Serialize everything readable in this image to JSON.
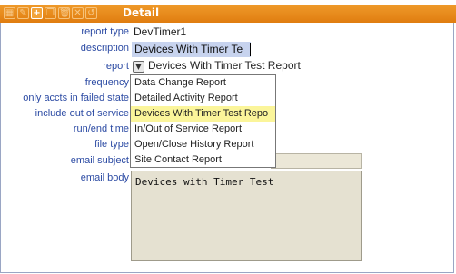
{
  "titlebar": {
    "title": "Detail",
    "buttons": [
      {
        "icon": "grid-icon",
        "glyph": "▦"
      },
      {
        "icon": "edit-icon",
        "glyph": "✎"
      },
      {
        "icon": "add-icon",
        "glyph": "+"
      },
      {
        "icon": "copy-icon",
        "glyph": "❐"
      },
      {
        "icon": "delete-icon",
        "glyph": "🗑"
      },
      {
        "icon": "close-icon",
        "glyph": "✕"
      },
      {
        "icon": "undo-icon",
        "glyph": "↺"
      }
    ]
  },
  "fields": {
    "report_type": {
      "label": "report type",
      "value": "DevTimer1"
    },
    "description": {
      "label": "description",
      "value": "Devices With Timer Te"
    },
    "report": {
      "label": "report",
      "value": "Devices With Timer Test Report",
      "icon": "select-arrow-icon"
    },
    "frequency": {
      "label": "frequency"
    },
    "only_accts_failed": {
      "label": "only accts in failed state"
    },
    "include_out_of_service": {
      "label": "include out of service"
    },
    "run_end_time": {
      "label": "run/end time"
    },
    "file_type": {
      "label": "file type"
    },
    "email_subject": {
      "label": "email subject",
      "value": ""
    },
    "email_body": {
      "label": "email body",
      "value": "Devices with Timer Test"
    }
  },
  "report_dropdown": {
    "options": [
      "Data Change Report",
      "Detailed Activity Report",
      "Devices With Timer Test Repo",
      "In/Out of Service Report",
      "Open/Close History Report",
      "Site Contact Report"
    ],
    "highlighted_index": 2
  },
  "colors": {
    "titlebar": "#e8891a",
    "label": "#2b4aa3",
    "highlight": "#fbf59a",
    "input_bg": "#e5e1d1"
  }
}
